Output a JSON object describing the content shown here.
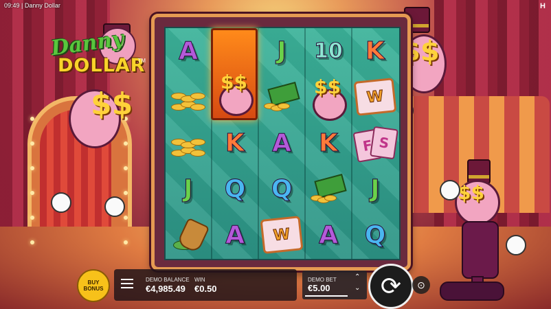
{
  "status_bar": {
    "time": "09:49",
    "title": "| Danny Dollar",
    "corner_mark": "H"
  },
  "logo": {
    "line1": "Danny",
    "line2": "DOLLAR",
    "tm": "TM"
  },
  "mascot_eyes": "$$",
  "reels": {
    "columns": [
      [
        "A",
        "coins",
        "coins",
        "J",
        "bucket"
      ],
      [
        "wild-expanded",
        "wild-expanded",
        "K",
        "Q",
        "A"
      ],
      [
        "J",
        "cash",
        "A",
        "Q",
        "W-card"
      ],
      [
        "10",
        "wild-clown",
        "K",
        "cash",
        "A"
      ],
      [
        "K",
        "W-card",
        "FS-cards",
        "J",
        "Q"
      ]
    ],
    "wild_card_letter": "W",
    "fs_letters": [
      "F",
      "S"
    ]
  },
  "controls": {
    "buy_bonus": [
      "BUY",
      "BONUS"
    ],
    "balance_label": "DEMO BALANCE",
    "balance_value": "€4,985.49",
    "win_label": "WIN",
    "win_value": "€0.50",
    "bet_label": "DEMO BET",
    "bet_value": "€5.00",
    "bet_up": "⌃",
    "bet_down": "⌄",
    "spin_icon": "⟳",
    "autoplay_icon": "⊙"
  },
  "colors": {
    "button_yellow": "#f7c11a",
    "reel_teal": "#3cb39a",
    "frame_orange": "#e59a52"
  }
}
